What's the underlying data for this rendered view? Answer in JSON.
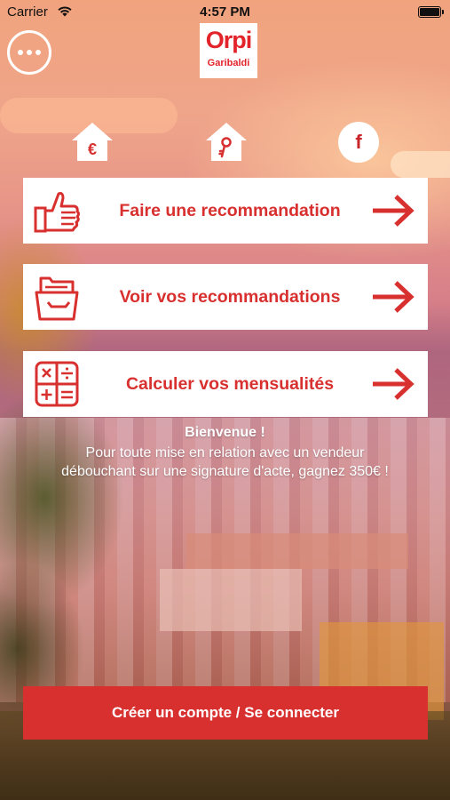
{
  "status_bar": {
    "carrier": "Carrier",
    "time": "4:57 PM",
    "wifi_icon": "wifi-icon",
    "battery_icon": "battery-icon"
  },
  "header": {
    "menu_icon": "more-horizontal-icon",
    "logo_main": "Orpi",
    "logo_sub": "Garibaldi"
  },
  "top_icons": [
    {
      "name": "euro-house-icon",
      "glyph": "€"
    },
    {
      "name": "key-house-icon",
      "glyph": "key"
    },
    {
      "name": "facebook-icon",
      "glyph": "f"
    }
  ],
  "actions": [
    {
      "label": "Faire une recommandation",
      "icon": "thumbs-up-icon",
      "arrow": "arrow-right-icon"
    },
    {
      "label": "Voir vos recommandations",
      "icon": "folder-tray-icon",
      "arrow": "arrow-right-icon"
    },
    {
      "label": "Calculer vos mensualités",
      "icon": "calculator-icon",
      "arrow": "arrow-right-icon"
    }
  ],
  "welcome": {
    "title": "Bienvenue !",
    "line1": "Pour toute mise en relation avec un vendeur",
    "line2": "débouchant sur une signature d'acte, gagnez 350€ !"
  },
  "cta": {
    "label": "Créer un compte / Se connecter"
  },
  "colors": {
    "brand_red": "#d8302f",
    "logo_red": "#e2232a",
    "card_bg": "#ffffff"
  }
}
